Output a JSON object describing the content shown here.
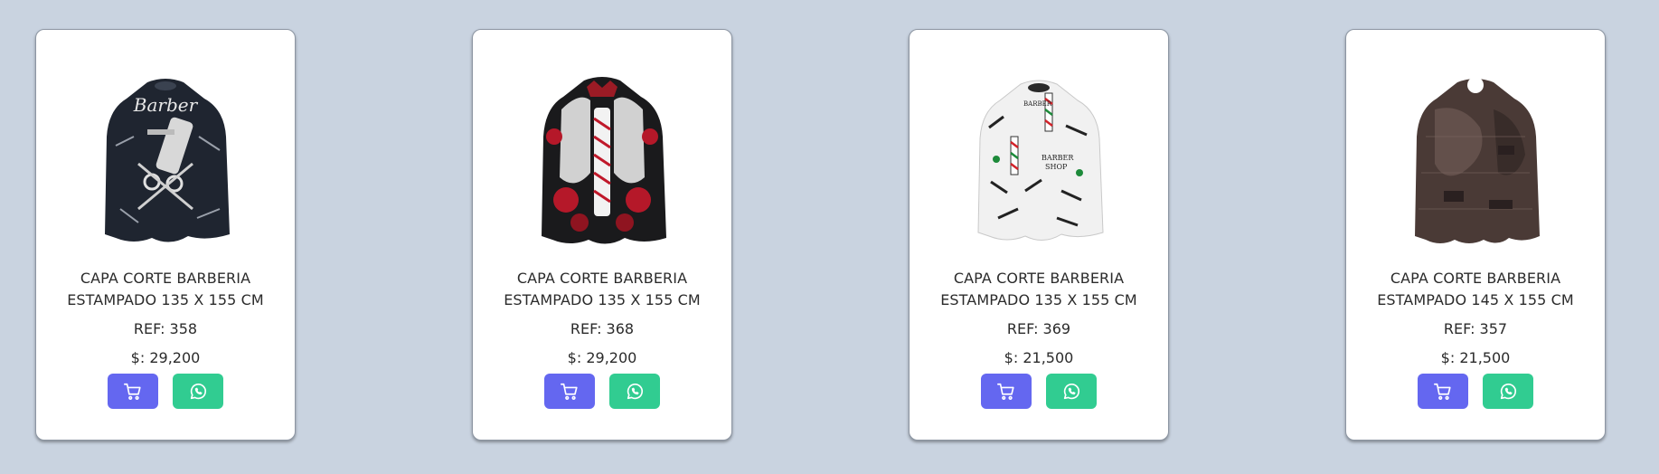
{
  "colors": {
    "background": "#c9d3e0",
    "card": "#ffffff",
    "cart_button": "#6467f0",
    "whatsapp_button": "#31cc91"
  },
  "products": [
    {
      "title_line1": "CAPA CORTE BARBERIA",
      "title_line2": "ESTAMPADO 135 X 155 CM",
      "ref": "REF: 358",
      "price": "$: 29,200",
      "cart_icon": "cart-icon",
      "whatsapp_icon": "whatsapp-icon"
    },
    {
      "title_line1": "CAPA CORTE BARBERIA",
      "title_line2": "ESTAMPADO 135 X 155 CM",
      "ref": "REF: 368",
      "price": "$: 29,200",
      "cart_icon": "cart-icon",
      "whatsapp_icon": "whatsapp-icon"
    },
    {
      "title_line1": "CAPA CORTE BARBERIA",
      "title_line2": "ESTAMPADO 135 X 155 CM",
      "ref": "REF: 369",
      "price": "$: 21,500",
      "cart_icon": "cart-icon",
      "whatsapp_icon": "whatsapp-icon"
    },
    {
      "title_line1": "CAPA CORTE BARBERIA",
      "title_line2": "ESTAMPADO 145 X 155 CM",
      "ref": "REF: 357",
      "price": "$: 21,500",
      "cart_icon": "cart-icon",
      "whatsapp_icon": "whatsapp-icon"
    }
  ]
}
